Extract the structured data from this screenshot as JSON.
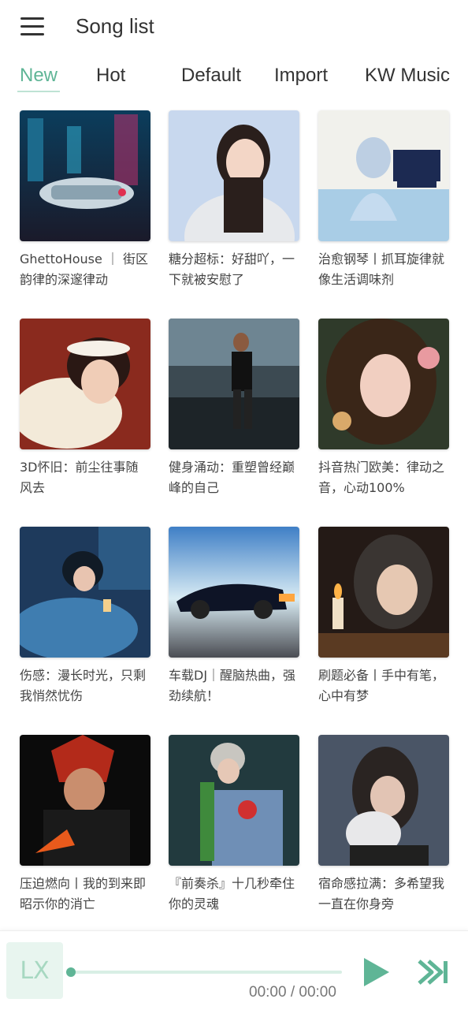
{
  "header": {
    "title": "Song list",
    "menu_icon": "hamburger-menu-icon"
  },
  "tabs": [
    {
      "label": "New",
      "active": true
    },
    {
      "label": "Hot",
      "active": false
    },
    {
      "label": "Default",
      "active": false
    },
    {
      "label": "Import",
      "active": false
    },
    {
      "label": "KW Music",
      "active": false
    }
  ],
  "colors": {
    "accent": "#5fb596",
    "accent_light": "#d8efe5"
  },
  "playlists": [
    {
      "title": "GhettoHouse ｜ 街区韵律的深邃律动"
    },
    {
      "title": "糖分超标：好甜吖，一下就被安慰了"
    },
    {
      "title": "治愈钢琴丨抓耳旋律就像生活调味剂"
    },
    {
      "title": "3D怀旧：前尘往事随风去"
    },
    {
      "title": "健身涌动：重塑曾经巅峰的自己"
    },
    {
      "title": "抖音热门欧美：律动之音，心动100%"
    },
    {
      "title": "伤感：漫长时光，只剩我悄然忧伤"
    },
    {
      "title": "车载DJ｜醒脑热曲，强劲续航！"
    },
    {
      "title": "刷题必备丨手中有笔，心中有梦"
    },
    {
      "title": "压迫燃向丨我的到来即昭示你的消亡"
    },
    {
      "title": "『前奏杀』十几秒牵住你的灵魂"
    },
    {
      "title": "宿命感拉满：多希望我一直在你身旁"
    }
  ],
  "player": {
    "logo": "LX",
    "time": "00:00 / 00:00",
    "progress": 0,
    "play_icon": "play-icon",
    "next_icon": "skip-next-icon"
  }
}
